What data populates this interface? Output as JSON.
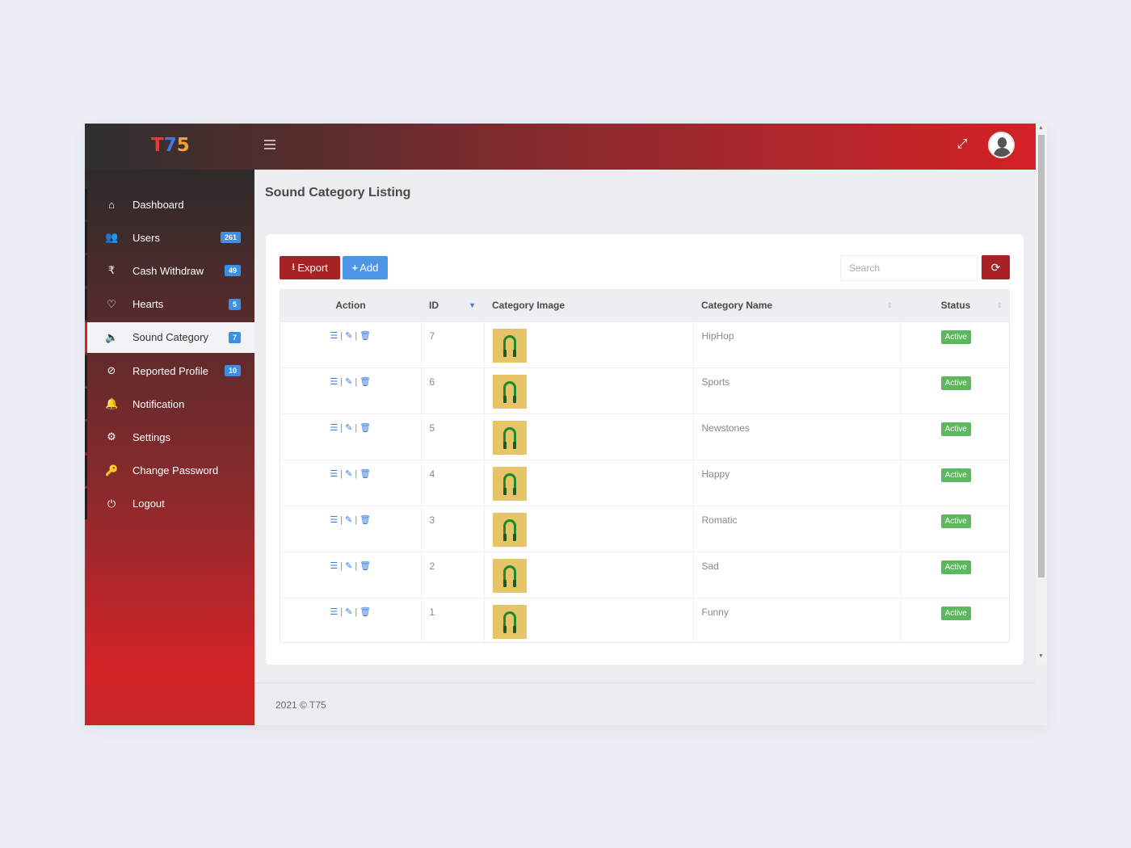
{
  "app": {
    "logo": {
      "t": "T",
      "seven": "7",
      "five": "5"
    },
    "colors": {
      "accent_red": "#d32327",
      "badge_blue": "#3d8ee6",
      "status_green": "#5cb85c",
      "export_red": "#a82124",
      "add_blue": "#4d96e5"
    }
  },
  "topbar": {
    "menu_icon": "hamburger-icon",
    "fullscreen_icon": "expand-icon",
    "avatar_icon": "user-avatar-icon"
  },
  "sidebar": {
    "items": [
      {
        "label": "Dashboard",
        "icon": "⌂",
        "badge": null
      },
      {
        "label": "Users",
        "icon": "👥",
        "badge": "261"
      },
      {
        "label": "Cash Withdraw",
        "icon": "₹",
        "badge": "49"
      },
      {
        "label": "Hearts",
        "icon": "♡",
        "badge": "5"
      },
      {
        "label": "Sound Category",
        "icon": "🔈",
        "badge": "7",
        "active": true
      },
      {
        "label": "Reported Profile",
        "icon": "⊘",
        "badge": "10"
      },
      {
        "label": "Notification",
        "icon": "🔔",
        "badge": null
      },
      {
        "label": "Settings",
        "icon": "⚙",
        "badge": null
      },
      {
        "label": "Change Password",
        "icon": "🔑",
        "badge": null
      },
      {
        "label": "Logout",
        "icon": "⏻",
        "badge": null
      }
    ]
  },
  "main": {
    "title": "Sound Category Listing",
    "toolbar": {
      "export_label": "Export",
      "export_icon": "⭳",
      "add_label": "Add",
      "add_icon": "+",
      "search_placeholder": "Search",
      "refresh_icon": "⟳"
    },
    "table": {
      "columns": [
        "Action",
        "ID",
        "Category Image",
        "Category Name",
        "Status"
      ],
      "rows": [
        {
          "id": "7",
          "name": "HipHop",
          "status": "Active"
        },
        {
          "id": "6",
          "name": "Sports",
          "status": "Active"
        },
        {
          "id": "5",
          "name": "Newstones",
          "status": "Active"
        },
        {
          "id": "4",
          "name": "Happy",
          "status": "Active"
        },
        {
          "id": "3",
          "name": "Romatic",
          "status": "Active"
        },
        {
          "id": "2",
          "name": "Sad",
          "status": "Active"
        },
        {
          "id": "1",
          "name": "Funny",
          "status": "Active"
        }
      ],
      "action_icons": {
        "view": "☰",
        "edit": "✎",
        "delete": "🗑",
        "separator": "|"
      }
    }
  },
  "footer": {
    "text": "2021 © T75"
  }
}
